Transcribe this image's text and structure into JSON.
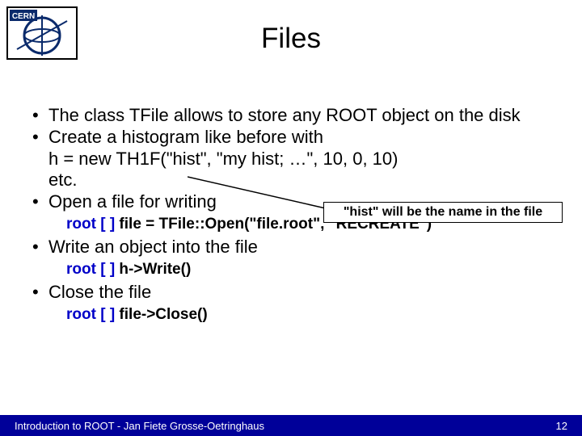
{
  "title": "Files",
  "bullets": {
    "b1": "The class TFile allows to store any ROOT object on the disk",
    "b2": "Create a histogram like before with",
    "b2_code": "h = new TH1F(\"hist\", \"my hist; …\", 10, 0, 10)",
    "b2_etc": "etc.",
    "b3": "Open a file for writing",
    "c1_prefix": "root [ ]",
    "c1": " file = TFile::Open(\"file.root\", \"RECREATE\")",
    "b4": "Write an object into the file",
    "c2_prefix": "root [ ]",
    "c2": " h->Write()",
    "b5": "Close the file",
    "c3_prefix": "root [ ]",
    "c3": " file->Close()"
  },
  "callout": "\"hist\" will be the name in the file",
  "footer_left": "Introduction to ROOT - Jan Fiete Grosse-Oetringhaus",
  "footer_right": "12",
  "logo_text": "CERN"
}
